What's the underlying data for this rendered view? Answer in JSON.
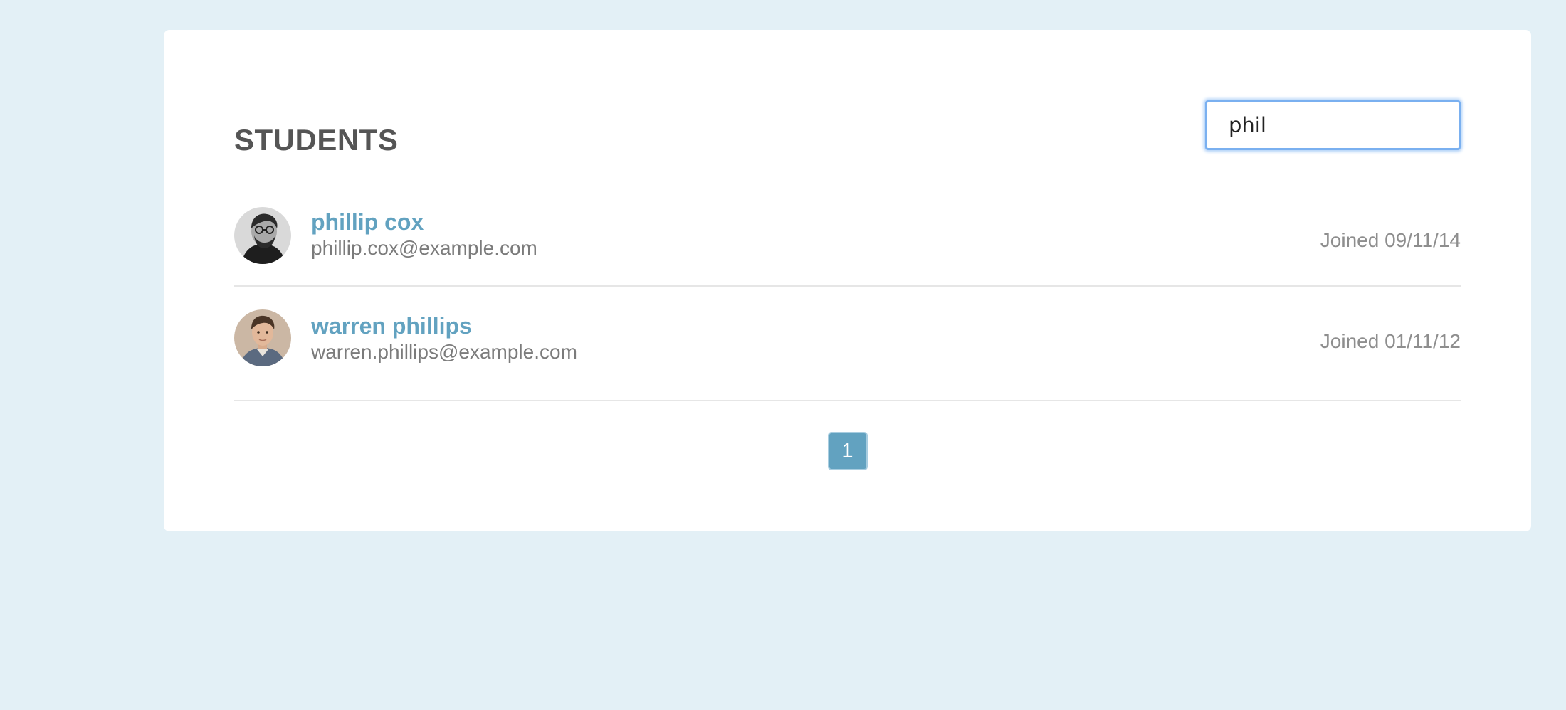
{
  "page": {
    "title": "STUDENTS"
  },
  "search": {
    "value": "phil",
    "placeholder": ""
  },
  "students": [
    {
      "name": "phillip cox",
      "email": "phillip.cox@example.com",
      "joined": "Joined 09/11/14",
      "avatar_icon": "avatar-phillip-cox"
    },
    {
      "name": "warren phillips",
      "email": "warren.phillips@example.com",
      "joined": "Joined 01/11/12",
      "avatar_icon": "avatar-warren-phillips"
    }
  ],
  "pagination": {
    "current_page": "1"
  },
  "colors": {
    "background": "#e3f0f6",
    "card": "#ffffff",
    "accent": "#62a2c0",
    "title": "#555555",
    "secondary_text": "#7b7b7b",
    "search_focus": "#7ab0f0"
  }
}
